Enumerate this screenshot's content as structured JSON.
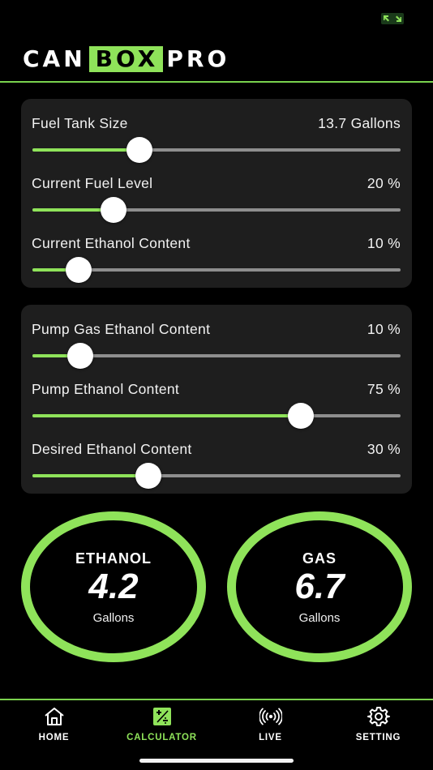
{
  "app": {
    "logo_left": "CAN",
    "logo_boxed": "BOX",
    "logo_right": "PRO"
  },
  "colors": {
    "accent": "#8fe35a",
    "card": "#1e1e1e",
    "track": "#8e8e8e",
    "background": "#000000"
  },
  "status_icon": "resize-arrows-icon",
  "tank_card": {
    "sliders": [
      {
        "label": "Fuel Tank Size",
        "value": "13.7 Gallons",
        "fraction": 0.29
      },
      {
        "label": "Current Fuel Level",
        "value": "20 %",
        "fraction": 0.22
      },
      {
        "label": "Current Ethanol Content",
        "value": "10 %",
        "fraction": 0.125
      }
    ]
  },
  "pump_card": {
    "sliders": [
      {
        "label": "Pump Gas Ethanol Content",
        "value": "10 %",
        "fraction": 0.13
      },
      {
        "label": "Pump Ethanol Content",
        "value": "75 %",
        "fraction": 0.73
      },
      {
        "label": "Desired Ethanol Content",
        "value": "30 %",
        "fraction": 0.315
      }
    ]
  },
  "results": {
    "ethanol": {
      "title": "ETHANOL",
      "value": "4.2",
      "unit": "Gallons"
    },
    "gas": {
      "title": "GAS",
      "value": "6.7",
      "unit": "Gallons"
    }
  },
  "nav": {
    "items": [
      {
        "label": "HOME",
        "icon": "home-icon",
        "active": false
      },
      {
        "label": "CALCULATOR",
        "icon": "calculator-icon",
        "active": true
      },
      {
        "label": "LIVE",
        "icon": "broadcast-icon",
        "active": false
      },
      {
        "label": "SETTING",
        "icon": "gear-icon",
        "active": false
      }
    ]
  }
}
